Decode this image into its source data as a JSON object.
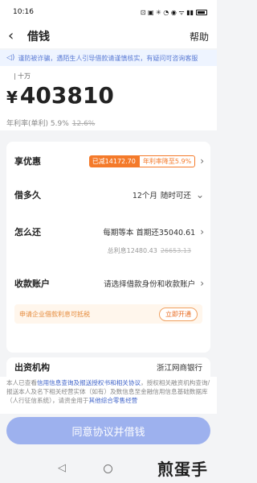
{
  "status_bar": {
    "time": "10:16",
    "icons": "⊡ ▣ ✳ ◔ ◉ ᯤ ▮▮"
  },
  "nav": {
    "title": "借钱",
    "help": "帮助"
  },
  "notice": {
    "text": "谨防被诈骗，遇陌生人引导借款请谨慎核实，有疑问可咨询客服"
  },
  "amount": {
    "unit_hint": "十万",
    "currency": "¥",
    "value": "403810",
    "rate_label": "年利率(单利) 5.9%",
    "original_rate": "12.6%"
  },
  "card": {
    "discount": {
      "label": "享优惠",
      "saved": "已减14172.70",
      "rate_drop": "年利率降至5.9%"
    },
    "term": {
      "label": "借多久",
      "value": "12个月",
      "action": "随时可还"
    },
    "repay": {
      "label": "怎么还",
      "value": "每期等本 首期还35040.61",
      "total_interest": "总利息12480.43",
      "original_interest": "26653.13"
    },
    "account": {
      "label": "收款账户",
      "value": "请选择借款身份和收款账户"
    },
    "enterprise": {
      "text": "申请企业借款利息可抵税",
      "button": "立即开通"
    }
  },
  "funder": {
    "label": "出资机构",
    "value": "浙江网商银行"
  },
  "agreement": {
    "prefix": "本人已查看",
    "link1": "信用信息查询及报送授权书和相关协议",
    "mid": "，授权相关融资机构查询/报送本人及名下相关经营实体（如有）及数信息至金融信用信息基础数据库（人行征信系统），请资金用于",
    "link2": "其他综合零售经营"
  },
  "submit": {
    "label": "同意协议并借钱"
  },
  "watermark": {
    "text": "煎蛋手游"
  },
  "colors": {
    "accent": "#f47a2a",
    "button": "#9db1ee",
    "link": "#3f63c9"
  }
}
